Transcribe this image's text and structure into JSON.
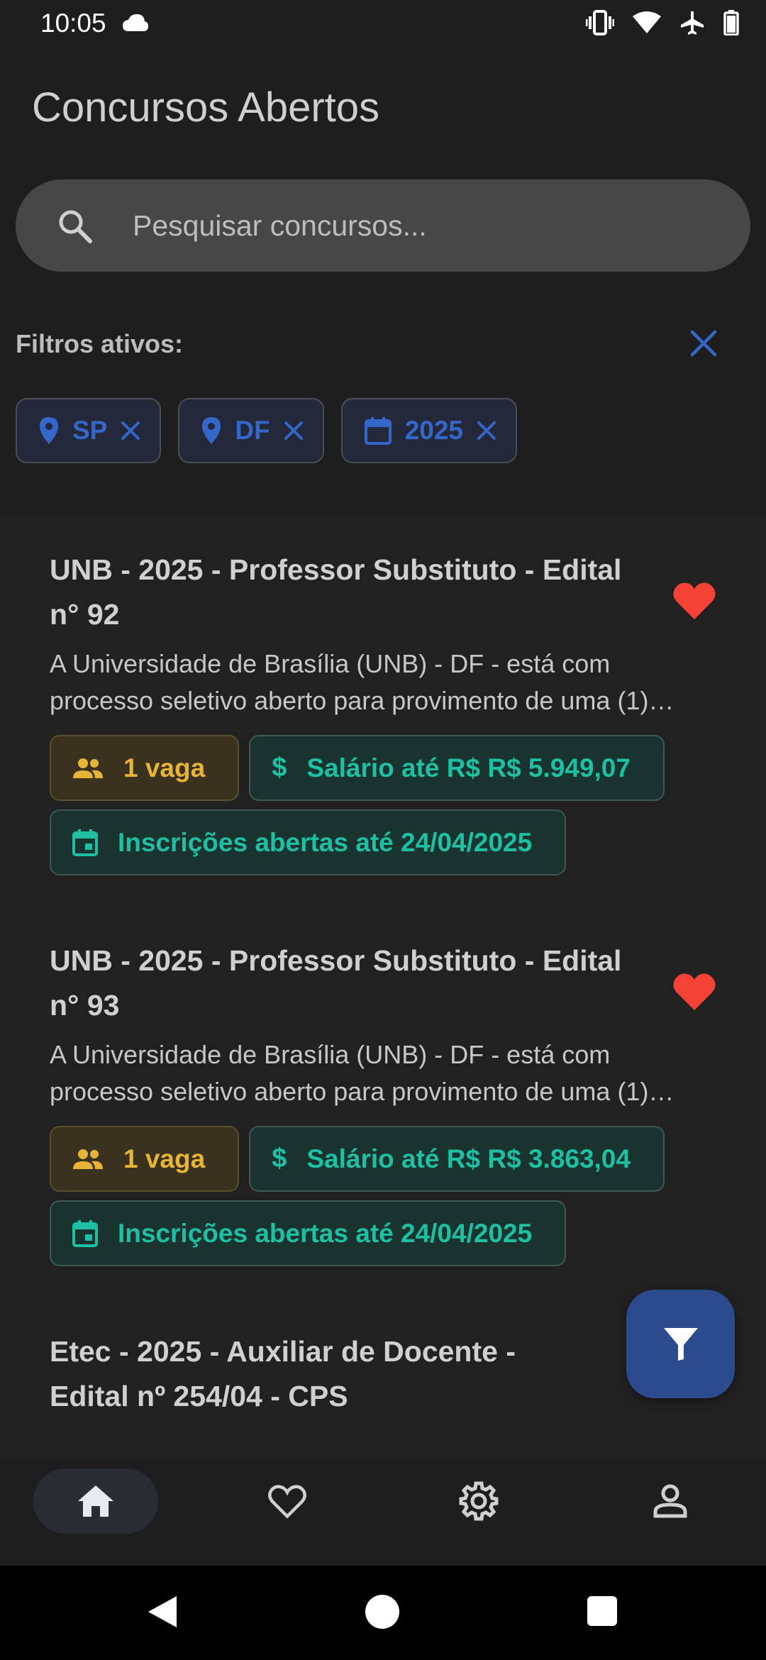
{
  "status_bar": {
    "time": "10:05"
  },
  "header": {
    "title": "Concursos Abertos"
  },
  "search": {
    "placeholder": "Pesquisar concursos..."
  },
  "filters": {
    "label": "Filtros ativos:",
    "chips": [
      {
        "icon": "location-pin-icon",
        "label": "SP"
      },
      {
        "icon": "location-pin-icon",
        "label": "DF"
      },
      {
        "icon": "calendar-icon",
        "label": "2025"
      }
    ]
  },
  "cards": [
    {
      "title": "UNB - 2025 - Professor Substituto - Edital n° 92",
      "description": "A Universidade de Brasília (UNB) - DF - está com processo seletivo aberto para provimento de uma (1)…",
      "favorite": true,
      "vagas": "1 vaga",
      "salario": "Salário até R$ R$ 5.949,07",
      "inscricoes": "Inscrições abertas até 24/04/2025"
    },
    {
      "title": "UNB - 2025 - Professor Substituto - Edital n° 93",
      "description": "A Universidade de Brasília (UNB) - DF - está com processo seletivo aberto para provimento de uma (1)…",
      "favorite": true,
      "vagas": "1 vaga",
      "salario": "Salário até R$ R$ 3.863,04",
      "inscricoes": "Inscrições abertas até 24/04/2025"
    },
    {
      "title": "Etec - 2025 - Auxiliar de Docente - Edital nº 254/04 - CPS"
    }
  ],
  "colors": {
    "background": "#1e1e1f",
    "accent_blue": "#3566c9",
    "favorite_red": "#f44336",
    "vaga_amber": "#e6b437",
    "teal": "#1ebfa3",
    "fab": "#2c4a8e"
  },
  "bottom_nav": {
    "items": [
      {
        "icon": "home-icon",
        "active": true
      },
      {
        "icon": "heart-outline-icon",
        "active": false
      },
      {
        "icon": "gear-icon",
        "active": false
      },
      {
        "icon": "person-icon",
        "active": false
      }
    ]
  }
}
